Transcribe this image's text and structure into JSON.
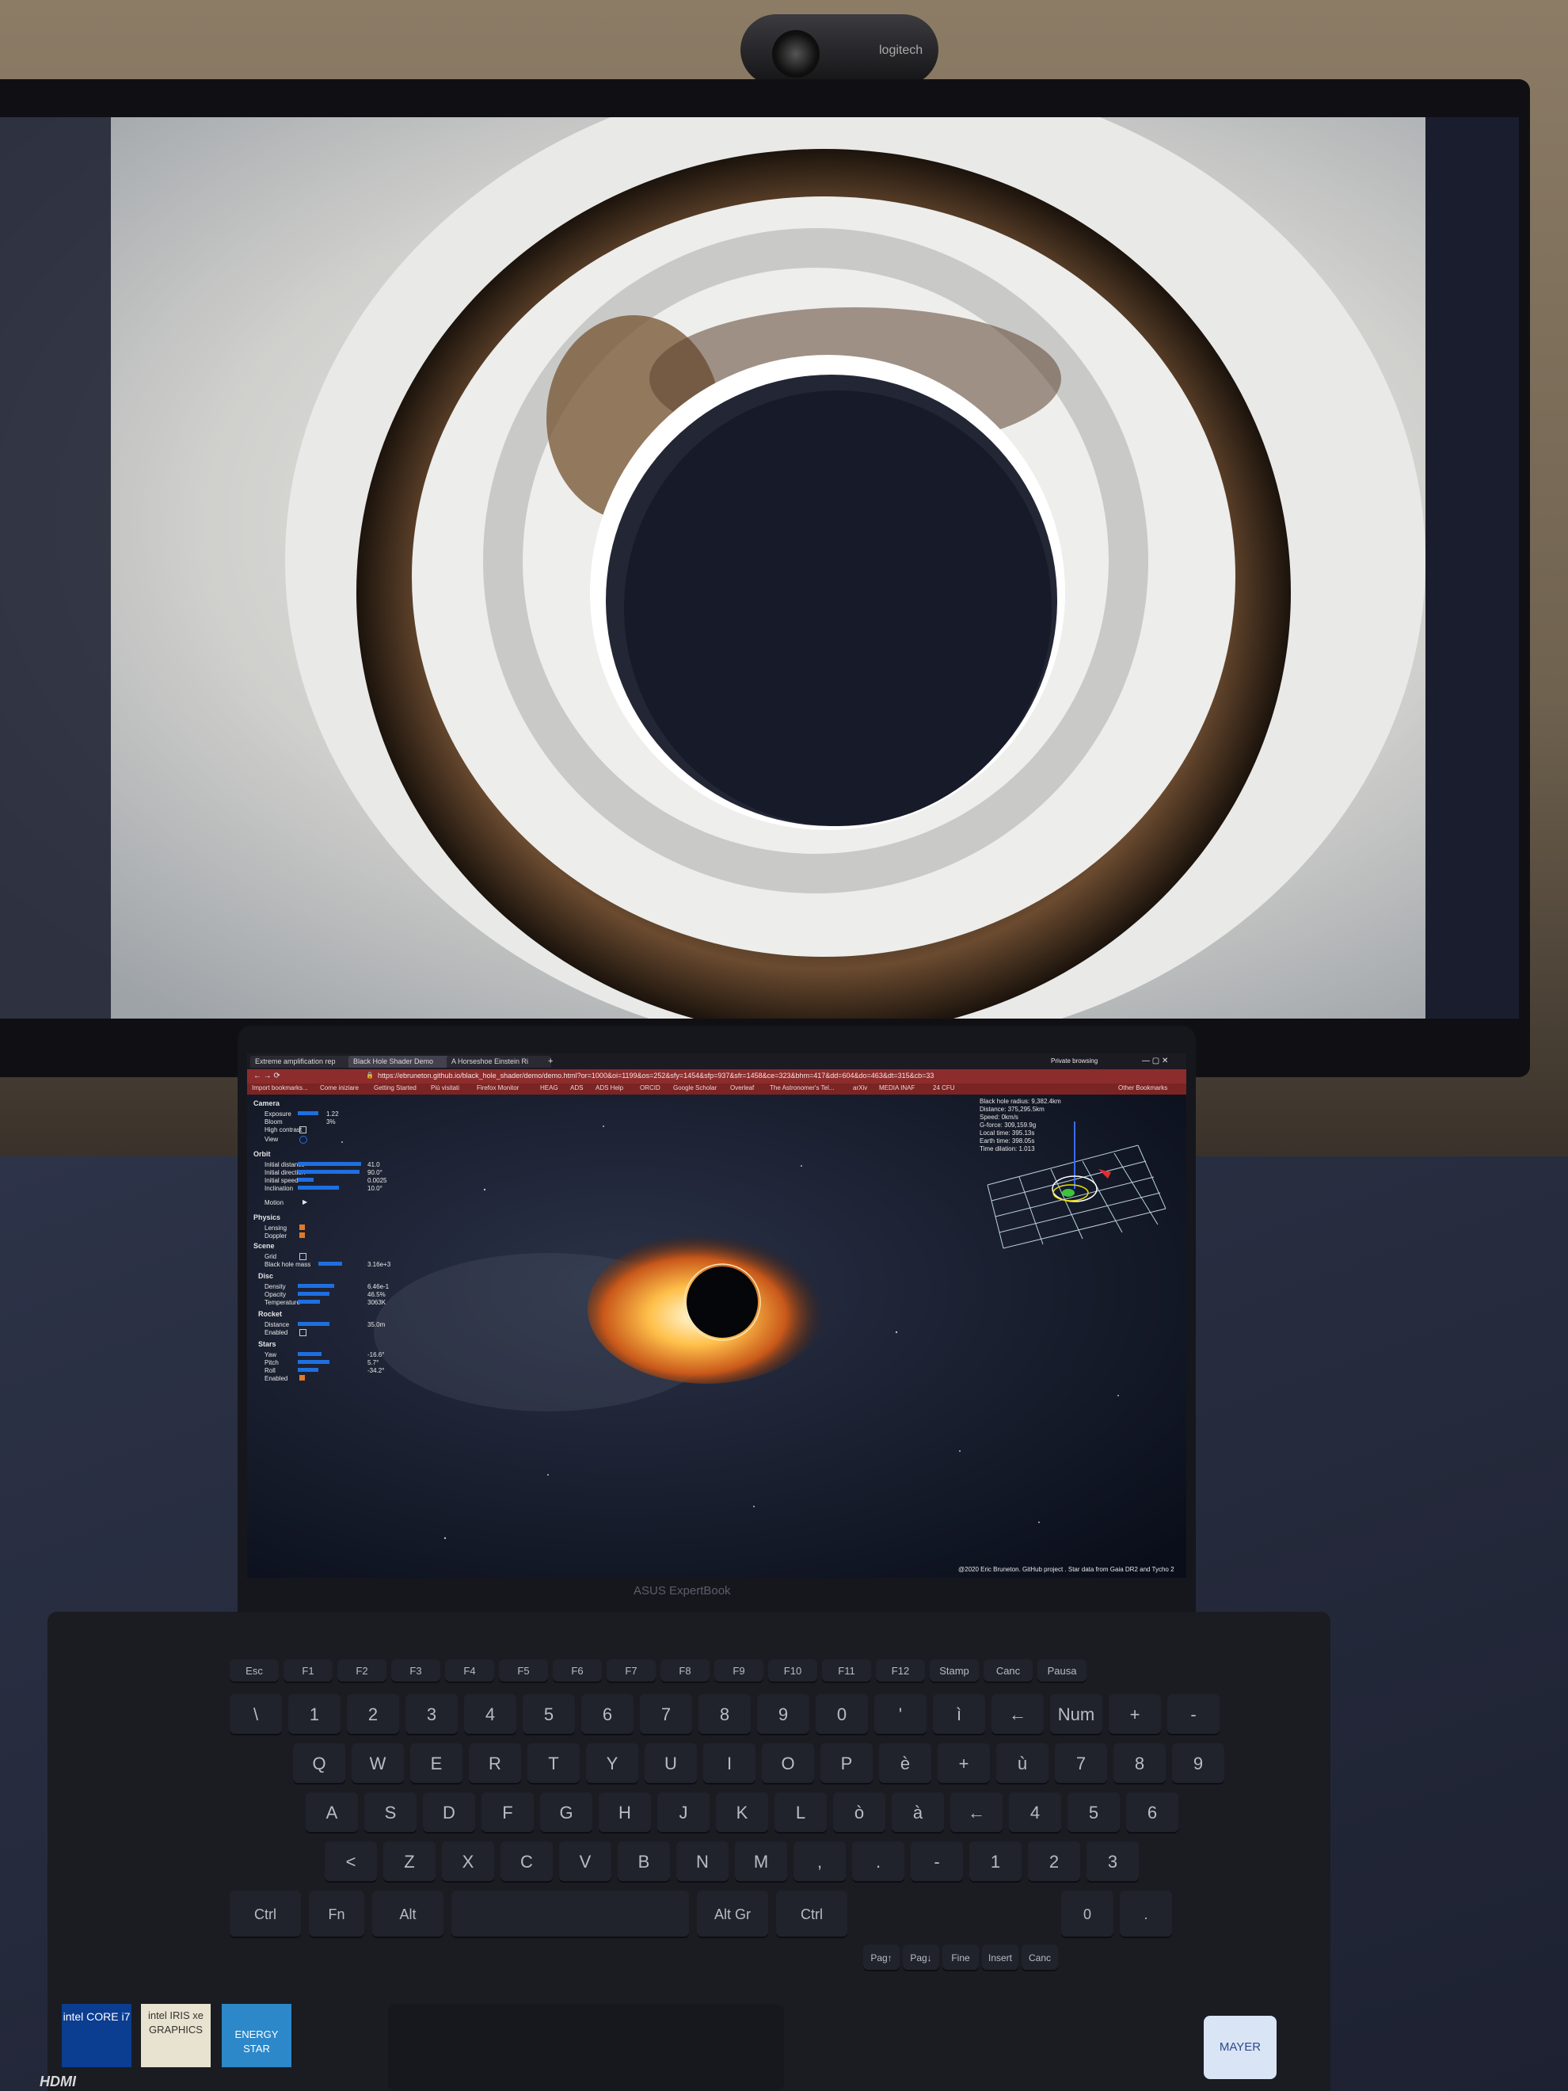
{
  "webcam": {
    "logo": "logitech"
  },
  "browser": {
    "tabs": [
      {
        "label": "Extreme amplification rep"
      },
      {
        "label": "Black Hole Shader Demo"
      },
      {
        "label": "A Horseshoe Einstein Ri"
      }
    ],
    "new_tab": "+",
    "private_label": "Private browsing",
    "url": "https://ebruneton.github.io/black_hole_shader/demo/demo.html?or=1000&oi=1199&os=252&sfy=1454&sfp=937&sfr=1458&ce=323&bhm=417&dd=604&do=463&dt=315&cb=33",
    "bookmarks": [
      "Import bookmarks...",
      "Come iniziare",
      "Getting Started",
      "Più visitati",
      "Firefox Monitor",
      "HEAG",
      "ADS",
      "ADS Help",
      "ORCID",
      "Google Scholar",
      "Overleaf",
      "The Astronomer's Tel...",
      "arXiv",
      "MEDIA INAF",
      "24 CFU"
    ],
    "other_bookmarks": "Other Bookmarks"
  },
  "controls": {
    "camera": {
      "title": "Camera",
      "exposure": "Exposure",
      "exposure_value": "1.22",
      "bloom": "Bloom",
      "bloom_value": "3%",
      "high_contrast": "High contrast",
      "view": "View"
    },
    "orbit": {
      "title": "Orbit",
      "initial_distance": "Initial distance",
      "initial_distance_value": "41.0",
      "initial_direction": "Initial direction",
      "initial_direction_value": "90.0°",
      "initial_speed": "Initial speed",
      "initial_speed_value": "0.0025",
      "inclination": "Inclination",
      "inclination_value": "10.0°",
      "motion": "Motion"
    },
    "physics": {
      "title": "Physics",
      "lensing": "Lensing",
      "doppler": "Doppler"
    },
    "scene": {
      "title": "Scene",
      "grid": "Grid",
      "black_hole_mass": "Black hole mass",
      "black_hole_mass_value": "3.16e+3"
    },
    "disc": {
      "title": "Disc",
      "density": "Density",
      "density_value": "6.46e-1",
      "opacity": "Opacity",
      "opacity_value": "46.5%",
      "temperature": "Temperature",
      "temperature_value": "3063K"
    },
    "rocket": {
      "title": "Rocket",
      "distance": "Distance",
      "distance_value": "35.0m",
      "enabled": "Enabled"
    },
    "stars": {
      "title": "Stars",
      "yaw": "Yaw",
      "yaw_value": "-16.6°",
      "pitch": "Pitch",
      "pitch_value": "5.7°",
      "roll": "Roll",
      "roll_value": "-34.2°",
      "enabled": "Enabled"
    }
  },
  "hud": {
    "lines": [
      "Black hole radius: 9,382.4km",
      "Distance: 375,295.5km",
      "Speed: 0km/s",
      "G-force: 309,159.9g",
      "Local time: 395.13s",
      "Earth time: 398.05s",
      "Time dilation: 1.013"
    ]
  },
  "credit": "@2020 Eric Bruneton. GitHub project . Star data from Gaia DR2 and Tycho 2",
  "laptop_brand": "ASUS ExpertBook",
  "keyboard": {
    "fn_row": [
      "Esc",
      "F1",
      "F2",
      "F3",
      "F4",
      "F5",
      "F6",
      "F7",
      "F8",
      "F9",
      "F10",
      "F11",
      "F12",
      "Stamp",
      "Canc",
      "Pausa"
    ],
    "row1": [
      "\\",
      "1",
      "2",
      "3",
      "4",
      "5",
      "6",
      "7",
      "8",
      "9",
      "0",
      "'",
      "ì",
      "←",
      "Num Lk",
      "+",
      "-"
    ],
    "row2": [
      "Q",
      "W",
      "E",
      "R",
      "T",
      "Y",
      "U",
      "I",
      "O",
      "P",
      "è",
      "+",
      "ù",
      "7",
      "8",
      "9"
    ],
    "row3": [
      "A",
      "S",
      "D",
      "F",
      "G",
      "H",
      "J",
      "K",
      "L",
      "ò",
      "à",
      "←",
      "4",
      "5",
      "6"
    ],
    "row4": [
      "<",
      "Z",
      "X",
      "C",
      "V",
      "B",
      "N",
      "M",
      ",",
      ".",
      "-",
      "1",
      "2",
      "3"
    ],
    "row5": [
      "Ctrl",
      "Fn",
      "Alt",
      "Alt Gr",
      "Ctrl",
      "0",
      "."
    ],
    "nav": [
      "Pag↑",
      "Pag↓",
      "Fine",
      "Insert",
      "Canc"
    ]
  },
  "stickers": [
    "intel CORE i7",
    "intel IRIS xe GRAPHICS",
    "ENERGY STAR",
    "MAYER",
    "HDMI"
  ]
}
